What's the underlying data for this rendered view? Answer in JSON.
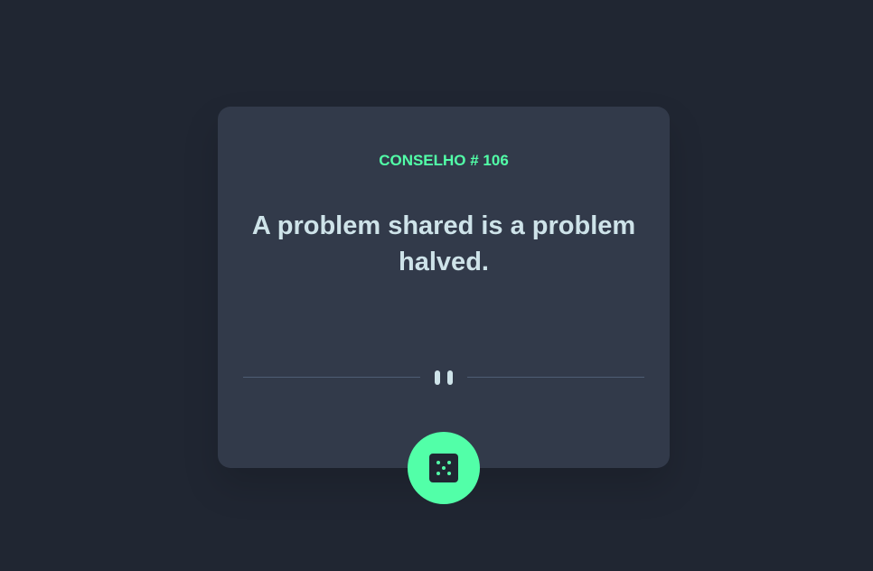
{
  "card": {
    "advice_id_label": "CONSELHO # 106",
    "advice_text": "A problem shared is a problem halved."
  },
  "divider": {
    "icon": "pause-icon"
  },
  "generate_button": {
    "icon": "dice-icon"
  },
  "colors": {
    "background": "#202632",
    "card": "#323a4a",
    "accent": "#52ffa8",
    "text": "#cee3e9",
    "divider": "#4f5d74"
  }
}
